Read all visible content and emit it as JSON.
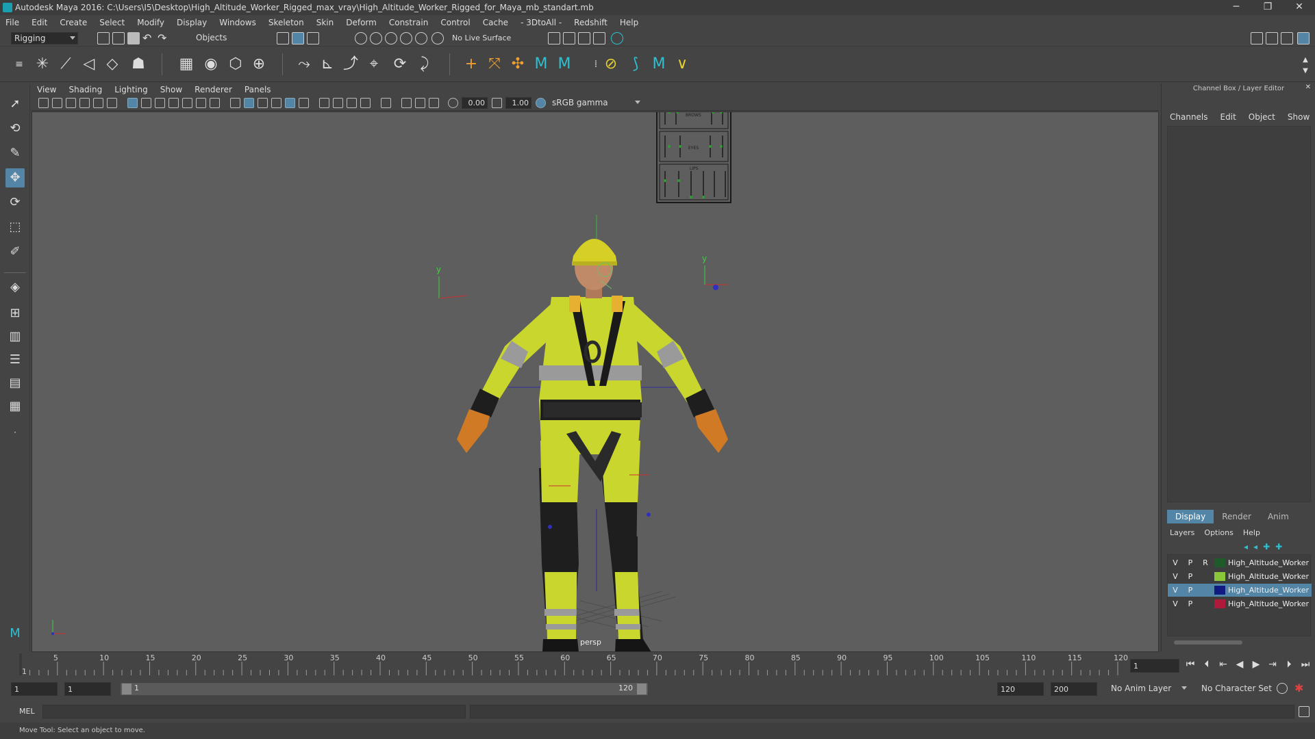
{
  "window": {
    "title": "Autodesk Maya 2016: C:\\Users\\I5\\Desktop\\High_Altitude_Worker_Rigged_max_vray\\High_Altitude_Worker_Rigged_for_Maya_mb_standart.mb",
    "minimize": "─",
    "restore": "❐",
    "close": "✕"
  },
  "menubar": [
    "File",
    "Edit",
    "Create",
    "Select",
    "Modify",
    "Display",
    "Windows",
    "Skeleton",
    "Skin",
    "Deform",
    "Constrain",
    "Control",
    "Cache",
    "- 3DtoAll -",
    "Redshift",
    "Help"
  ],
  "statusline": {
    "menuset": "Rigging",
    "selection_mode": "Objects",
    "live_surface": "No Live Surface"
  },
  "viewport": {
    "menu": [
      "View",
      "Shading",
      "Lighting",
      "Show",
      "Renderer",
      "Panels"
    ],
    "exposure": "0.00",
    "gamma": "1.00",
    "color_space": "sRGB gamma",
    "camera": "persp",
    "control_panel_labels": [
      "BROWS",
      "EYES",
      "LIPS"
    ]
  },
  "right_panel": {
    "title": "Channel Box / Layer Editor",
    "menu": [
      "Channels",
      "Edit",
      "Object",
      "Show"
    ],
    "layer_tabs": [
      "Display",
      "Render",
      "Anim"
    ],
    "layer_menu": [
      "Layers",
      "Options",
      "Help"
    ],
    "layers": [
      {
        "v": "V",
        "p": "P",
        "r": "R",
        "color": "#1f5a2a",
        "name": "High_Altitude_Worker",
        "selected": false
      },
      {
        "v": "V",
        "p": "P",
        "r": "",
        "color": "#8ac63a",
        "name": "High_Altitude_Worker",
        "selected": false
      },
      {
        "v": "V",
        "p": "P",
        "r": "",
        "color": "#101a80",
        "name": "High_Altitude_Worker",
        "selected": true
      },
      {
        "v": "V",
        "p": "P",
        "r": "",
        "color": "#b01a3a",
        "name": "High_Altitude_Worker",
        "selected": false
      }
    ]
  },
  "timeline": {
    "ticks": [
      "1",
      "5",
      "10",
      "15",
      "20",
      "25",
      "30",
      "35",
      "40",
      "45",
      "50",
      "55",
      "60",
      "65",
      "70",
      "75",
      "80",
      "85",
      "90",
      "95",
      "100",
      "105",
      "110",
      "115",
      "120"
    ],
    "current_frame": "1",
    "range_start": "1",
    "anim_start": "1",
    "slider_start": "1",
    "slider_end": "120",
    "range_end": "120",
    "anim_end": "200",
    "anim_layer": "No Anim Layer",
    "character_set": "No Character Set"
  },
  "command": {
    "language": "MEL",
    "help": "Move Tool: Select an object to move."
  },
  "colors": {
    "accent": "#5285a6",
    "viewport_bg": "#5e5e5e",
    "vest_yellow": "#c9d62e"
  }
}
